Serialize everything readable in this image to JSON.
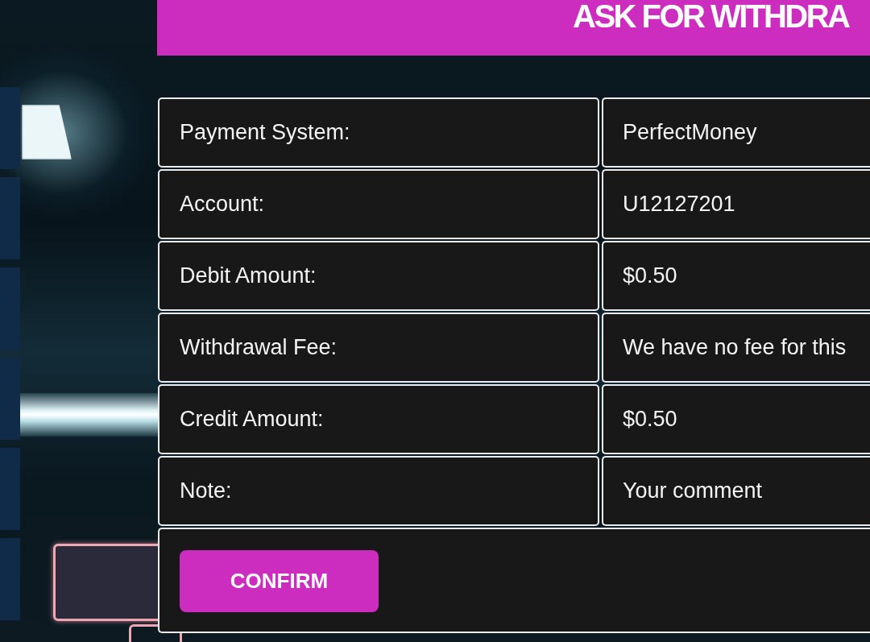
{
  "header": {
    "title": "ASK FOR WITHDRA"
  },
  "details": {
    "rows": [
      {
        "label": "Payment System:",
        "value": "PerfectMoney"
      },
      {
        "label": "Account:",
        "value": "U12127201"
      },
      {
        "label": "Debit Amount:",
        "value": "$0.50"
      },
      {
        "label": "Withdrawal Fee:",
        "value": "We have no fee for this"
      },
      {
        "label": "Credit Amount:",
        "value": "$0.50"
      },
      {
        "label": "Note:",
        "value": "Your comment"
      }
    ]
  },
  "confirm_button": {
    "label": "CONFIRM"
  }
}
